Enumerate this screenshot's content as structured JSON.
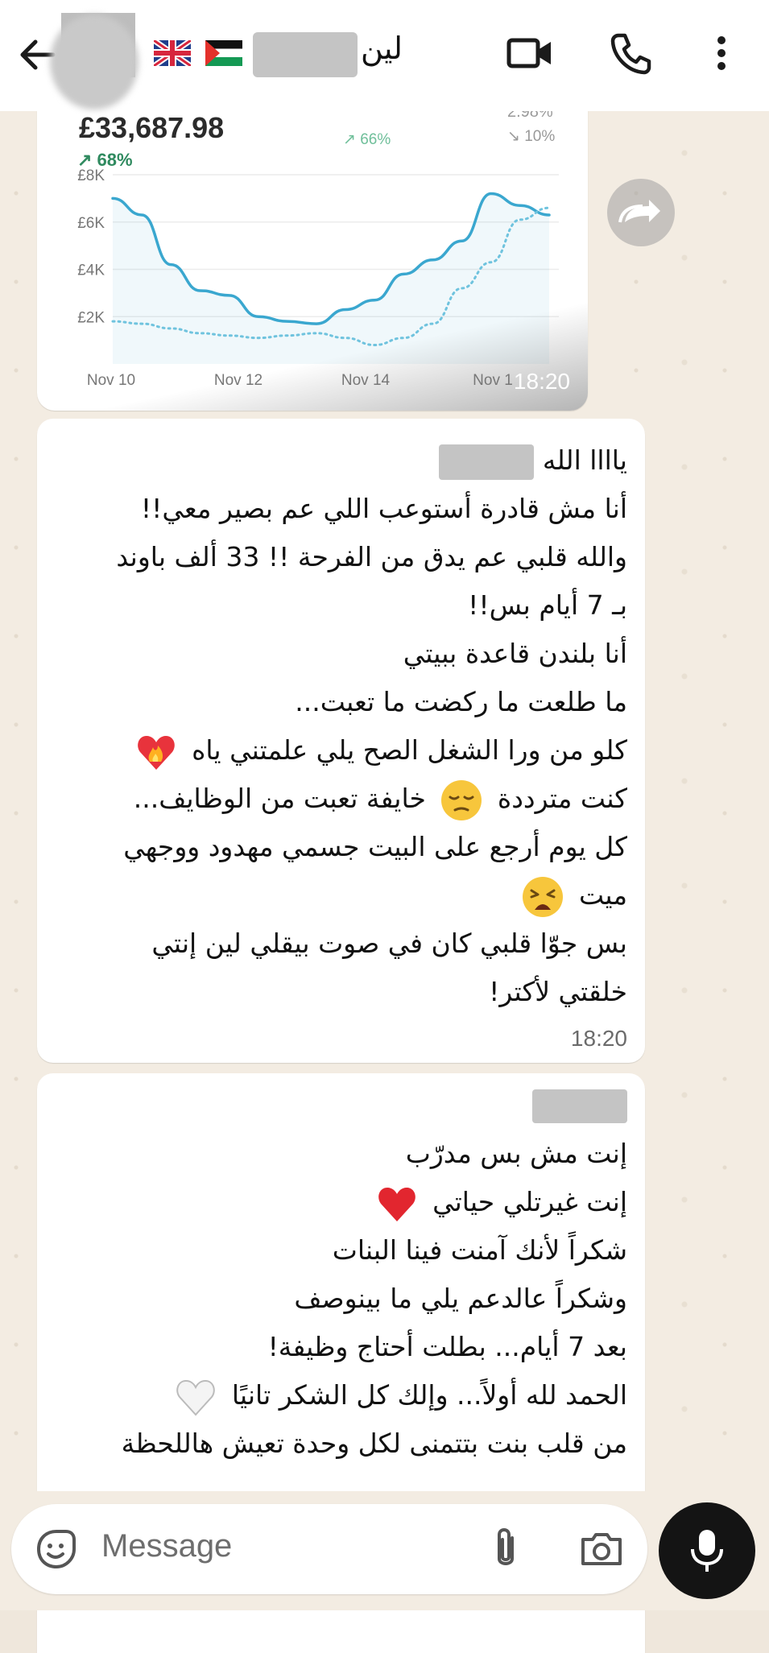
{
  "header": {
    "contact_name": "لين",
    "icons": [
      "back-arrow-icon",
      "uk-flag-icon",
      "palestine-flag-icon",
      "video-call-icon",
      "phone-call-icon",
      "more-options-icon"
    ]
  },
  "image_message": {
    "amount": "£33,687.98",
    "change": "↗ 68%",
    "stat_mid": "↗ 66%",
    "stat_right_top": "2.98%",
    "stat_right_bottom": "↘ 10%",
    "time": "18:20",
    "chart_data": {
      "type": "line",
      "title": "",
      "ytick_labels": [
        "£8K",
        "£6K",
        "£4K",
        "£2K"
      ],
      "xtick_labels": [
        "Nov 10",
        "Nov 12",
        "Nov 14",
        "Nov 1"
      ],
      "ylim": [
        0,
        8000
      ],
      "series": [
        {
          "style": "solid",
          "color": "#3aa7cf",
          "values": [
            7000,
            6300,
            4200,
            3100,
            2900,
            2000,
            1800,
            1700,
            2300,
            2700,
            3800,
            4400,
            5200,
            7200,
            6700,
            6300
          ]
        },
        {
          "style": "dotted",
          "color": "#6fc3de",
          "values": [
            1800,
            1700,
            1500,
            1300,
            1200,
            1100,
            1200,
            1300,
            1100,
            800,
            1100,
            1700,
            3200,
            4300,
            6100,
            6600
          ]
        }
      ]
    }
  },
  "message1": {
    "lines": [
      "ياااا الله",
      "أنا مش قادرة أستوعب اللي عم بصير معي!!",
      "والله قلبي عم يدق من الفرحة !! 33 ألف باوند",
      "بـ 7 أيام بس!!",
      "أنا بلندن قاعدة ببيتي",
      "ما طلعت ما ركضت ما تعبت...",
      "كلو من ورا الشغل الصح يلي علمتني ياه",
      "كنت مترددة",
      "خايفة تعبت من الوظايف...",
      "كل يوم أرجع على البيت جسمي مهدود ووجهي",
      "ميت",
      "بس جوّا قلبي كان في صوت بيقلي لين إنتي",
      "خلقتي لأكتر!"
    ],
    "time": "18:20"
  },
  "message2": {
    "lines": [
      "إنت مش بس مدرّب",
      "إنت غيرتلي حياتي",
      "شكراً لأنك آمنت فينا البنات",
      "وشكراً عالدعم يلي ما بينوصف",
      "بعد 7 أيام... بطلت أحتاج وظيفة!",
      "الحمد لله أولاً... وإلك كل الشكر تانيًا",
      "من قلب بنت بتتمنى لكل وحدة تعيش هاللحظة"
    ]
  },
  "composer": {
    "placeholder": "Message"
  }
}
